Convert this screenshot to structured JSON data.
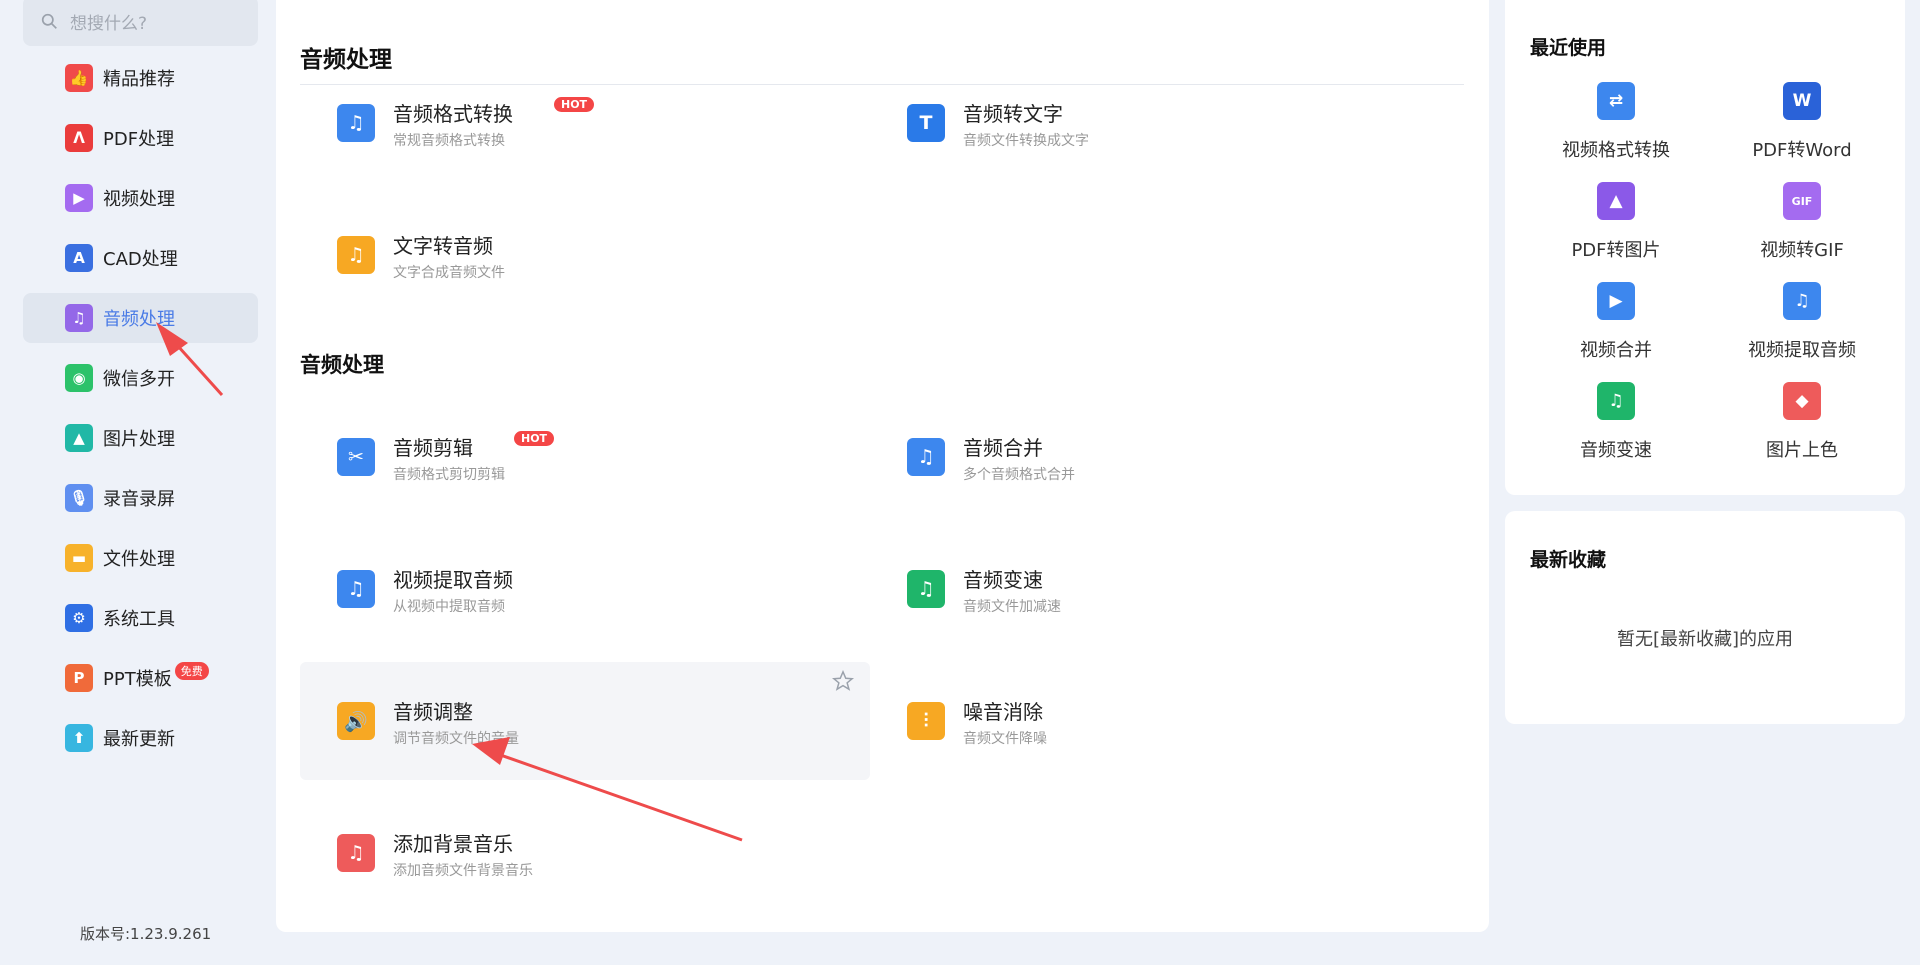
{
  "search": {
    "placeholder": "想搜什么?"
  },
  "sidebar": {
    "items": [
      {
        "label": "精品推荐",
        "icon": "thumbs-up-icon",
        "color": "#f04a4a",
        "glyph": "👍"
      },
      {
        "label": "PDF处理",
        "icon": "pdf-icon",
        "color": "#ea3c3c",
        "glyph": "ᐱ"
      },
      {
        "label": "视频处理",
        "icon": "video-play-icon",
        "color": "#a46bf0",
        "glyph": "▶"
      },
      {
        "label": "CAD处理",
        "icon": "cad-icon",
        "color": "#3a6fe0",
        "glyph": "A"
      },
      {
        "label": "音频处理",
        "icon": "music-note-icon",
        "color": "#9468e8",
        "glyph": "♫",
        "active": true
      },
      {
        "label": "微信多开",
        "icon": "wechat-icon",
        "color": "#2cc26a",
        "glyph": "◉"
      },
      {
        "label": "图片处理",
        "icon": "image-icon",
        "color": "#21b8a6",
        "glyph": "▲"
      },
      {
        "label": "录音录屏",
        "icon": "microphone-icon",
        "color": "#5f8ff0",
        "glyph": "🎙"
      },
      {
        "label": "文件处理",
        "icon": "folder-icon",
        "color": "#f7b22b",
        "glyph": "▬"
      },
      {
        "label": "系统工具",
        "icon": "gear-icon",
        "color": "#2f6fe4",
        "glyph": "⚙"
      },
      {
        "label": "PPT模板",
        "icon": "ppt-icon",
        "color": "#f06a3a",
        "glyph": "P",
        "badge": "免费"
      },
      {
        "label": "最新更新",
        "icon": "upload-icon",
        "color": "#37b6e0",
        "glyph": "⬆"
      }
    ],
    "version": "版本号:1.23.9.261"
  },
  "main": {
    "section1_title": "音频处理",
    "section2_title": "音频处理",
    "hot_label": "HOT",
    "tools": [
      {
        "name": "音频格式转换",
        "desc": "常规音频格式转换",
        "icon": "audio-convert-icon",
        "color": "#3d87ee",
        "glyph": "♫",
        "hot": true
      },
      {
        "name": "音频转文字",
        "desc": "音频文件转换成文字",
        "icon": "audio-to-text-icon",
        "color": "#2a7ae8",
        "glyph": "T"
      },
      {
        "name": "文字转音频",
        "desc": "文字合成音频文件",
        "icon": "text-to-audio-icon",
        "color": "#f7a823",
        "glyph": "♫"
      },
      {
        "name": "音频剪辑",
        "desc": "音频格式剪切剪辑",
        "icon": "audio-cut-icon",
        "color": "#3d87ee",
        "glyph": "✂",
        "hot": true
      },
      {
        "name": "音频合并",
        "desc": "多个音频格式合并",
        "icon": "audio-merge-icon",
        "color": "#3d87ee",
        "glyph": "♫"
      },
      {
        "name": "视频提取音频",
        "desc": "从视频中提取音频",
        "icon": "extract-audio-icon",
        "color": "#3d87ee",
        "glyph": "♫"
      },
      {
        "name": "音频变速",
        "desc": "音频文件加减速",
        "icon": "audio-speed-icon",
        "color": "#1fb56a",
        "glyph": "♫"
      },
      {
        "name": "音频调整",
        "desc": "调节音频文件的音量",
        "icon": "volume-icon",
        "color": "#f7a823",
        "glyph": "🔊",
        "hover": true
      },
      {
        "name": "噪音消除",
        "desc": "音频文件降噪",
        "icon": "noise-reduce-icon",
        "color": "#f7a823",
        "glyph": "⫶"
      },
      {
        "name": "添加背景音乐",
        "desc": "添加音频文件背景音乐",
        "icon": "background-music-icon",
        "color": "#ee5b5b",
        "glyph": "♫"
      }
    ]
  },
  "recent": {
    "title": "最近使用",
    "items": [
      {
        "label": "视频格式转换",
        "icon": "video-convert-icon",
        "color": "#3d87ee",
        "glyph": "⇄"
      },
      {
        "label": "PDF转Word",
        "icon": "pdf-to-word-icon",
        "color": "#2a62d8",
        "glyph": "W"
      },
      {
        "label": "PDF转图片",
        "icon": "pdf-to-image-icon",
        "color": "#8b59e8",
        "glyph": "▲"
      },
      {
        "label": "视频转GIF",
        "icon": "video-to-gif-icon",
        "color": "#a46bf0",
        "glyph": "GIF"
      },
      {
        "label": "视频合并",
        "icon": "video-merge-icon",
        "color": "#3d87ee",
        "glyph": "▶"
      },
      {
        "label": "视频提取音频",
        "icon": "extract-audio-icon",
        "color": "#3d87ee",
        "glyph": "♫"
      },
      {
        "label": "音频变速",
        "icon": "audio-speed-icon",
        "color": "#1fb56a",
        "glyph": "♫"
      },
      {
        "label": "图片上色",
        "icon": "image-color-icon",
        "color": "#ee5b5b",
        "glyph": "◆"
      }
    ]
  },
  "favorites": {
    "title": "最新收藏",
    "empty": "暂无[最新收藏]的应用"
  }
}
